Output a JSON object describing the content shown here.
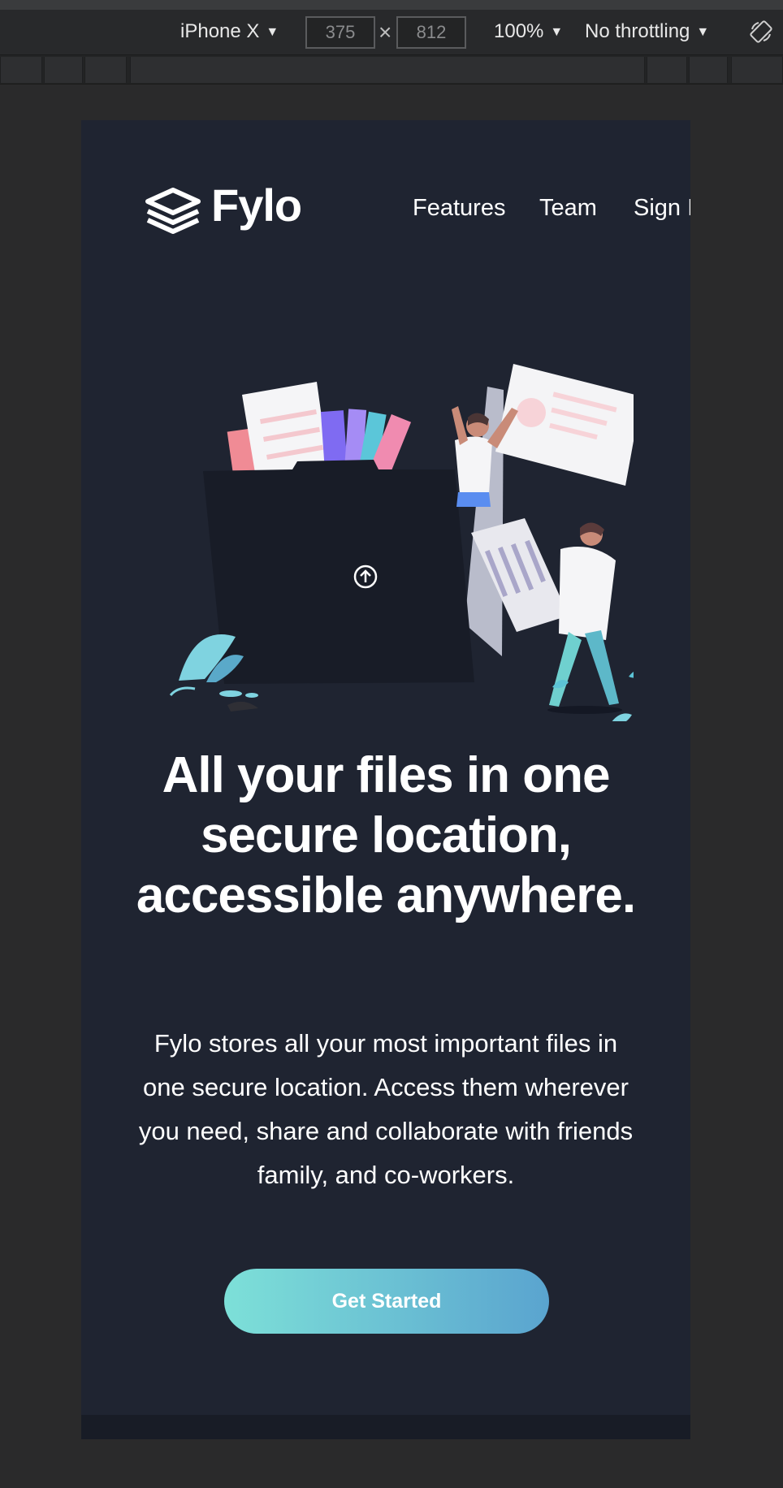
{
  "devtools": {
    "device": "iPhone X",
    "width": "375",
    "height": "812",
    "zoom": "100%",
    "throttling": "No throttling",
    "times": "×"
  },
  "nav": {
    "brand": "Fylo",
    "links": [
      "Features",
      "Team",
      "Sign In"
    ]
  },
  "hero": {
    "headline": "All your files in one secure location, accessible anywhere.",
    "description": "Fylo stores all your most important files in one secure location. Access them wherever you need, share and collaborate with friends family, and co-workers.",
    "cta": "Get Started"
  },
  "colors": {
    "page_bg": "#1f2431",
    "cta_start": "#7de0d8",
    "cta_end": "#5aa4cf"
  },
  "icons": [
    "stacked-layers-icon",
    "upload-arrow-icon",
    "rotate-device-icon",
    "caret-down-icon"
  ]
}
